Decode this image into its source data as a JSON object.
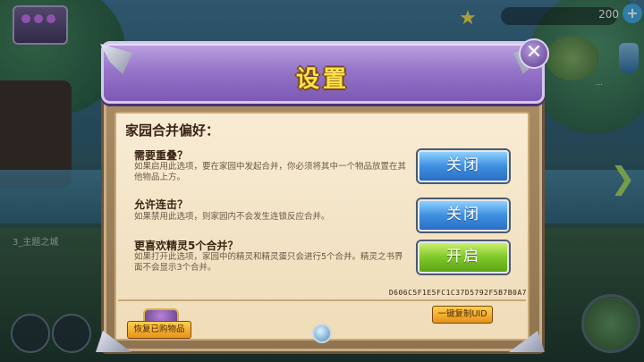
{
  "hud": {
    "count": "200",
    "plus": "+",
    "pet_label": "…",
    "bg_text": "3_主题之城"
  },
  "modal": {
    "title": "设置",
    "close": "✕",
    "section_title": "家园合并偏好：",
    "options": [
      {
        "title": "需要重叠？",
        "desc": "如果启用此选项，要在家园中发起合并，你必须将其中一个物品放置在其他物品上方。",
        "toggle": "关闭",
        "state": "off"
      },
      {
        "title": "允许连击？",
        "desc": "如果禁用此选项，则家园内不会发生连锁反应合并。",
        "toggle": "关闭",
        "state": "off"
      },
      {
        "title": "更喜欢精灵5个合并？",
        "desc": "如果打开此选项，家园中的精灵和精灵蛋只会进行5个合并。精灵之书界面不会显示3个合并。",
        "toggle": "开启",
        "state": "on"
      }
    ],
    "restore_button": "恢复已购物品",
    "uid": "D606C5F1E5FC1C37D5792F5B7B0A7",
    "copy_uid_button": "一键复制UID"
  },
  "colors": {
    "header_purple": "#9776c9",
    "title_yellow": "#ffe24a",
    "toggle_off_blue": "#3f8fe0",
    "toggle_on_green": "#7fc72a",
    "paper": "#f8ecd4"
  },
  "icons": [
    "chest-icon",
    "close-icon",
    "star-icon",
    "gem-icon",
    "arrow-right-icon"
  ]
}
